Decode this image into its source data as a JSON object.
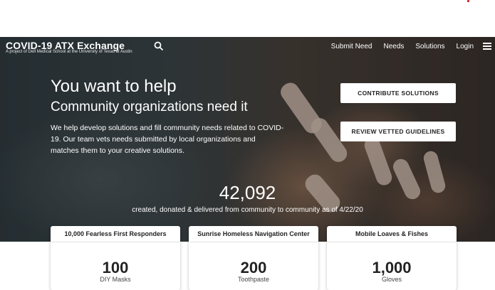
{
  "nav": {
    "brand": "COVID-19 ATX Exchange",
    "subtitle": "A project of Dell Medical School at the University of Texas at Austin",
    "links": [
      "Submit Need",
      "Needs",
      "Solutions",
      "Login"
    ]
  },
  "hero": {
    "headline": "You want to help",
    "subheadline": "Community organizations need it",
    "blurb": "We help develop solutions and fill community needs related to COVID-19. Our team vets needs submitted by local organizations and matches them to your creative solutions.",
    "cta_contribute": "CONTRIBUTE SOLUTIONS",
    "cta_guidelines": "REVIEW VETTED GUIDELINES"
  },
  "stats": {
    "total": "42,092",
    "caption": "created, donated & delivered from community to community as of 4/22/20"
  },
  "cards": [
    {
      "title": "10,000 Fearless First Responders",
      "number": "100",
      "label": "DIY Masks"
    },
    {
      "title": "Sunrise Homeless Navigation Center",
      "number": "200",
      "label": "Toothpaste"
    },
    {
      "title": "Mobile Loaves & Fishes",
      "number": "1,000",
      "label": "Gloves"
    }
  ],
  "colors": {
    "accent_dot": "#d0202c",
    "button_bg": "#ffffff",
    "text_on_hero": "#ffffff"
  }
}
